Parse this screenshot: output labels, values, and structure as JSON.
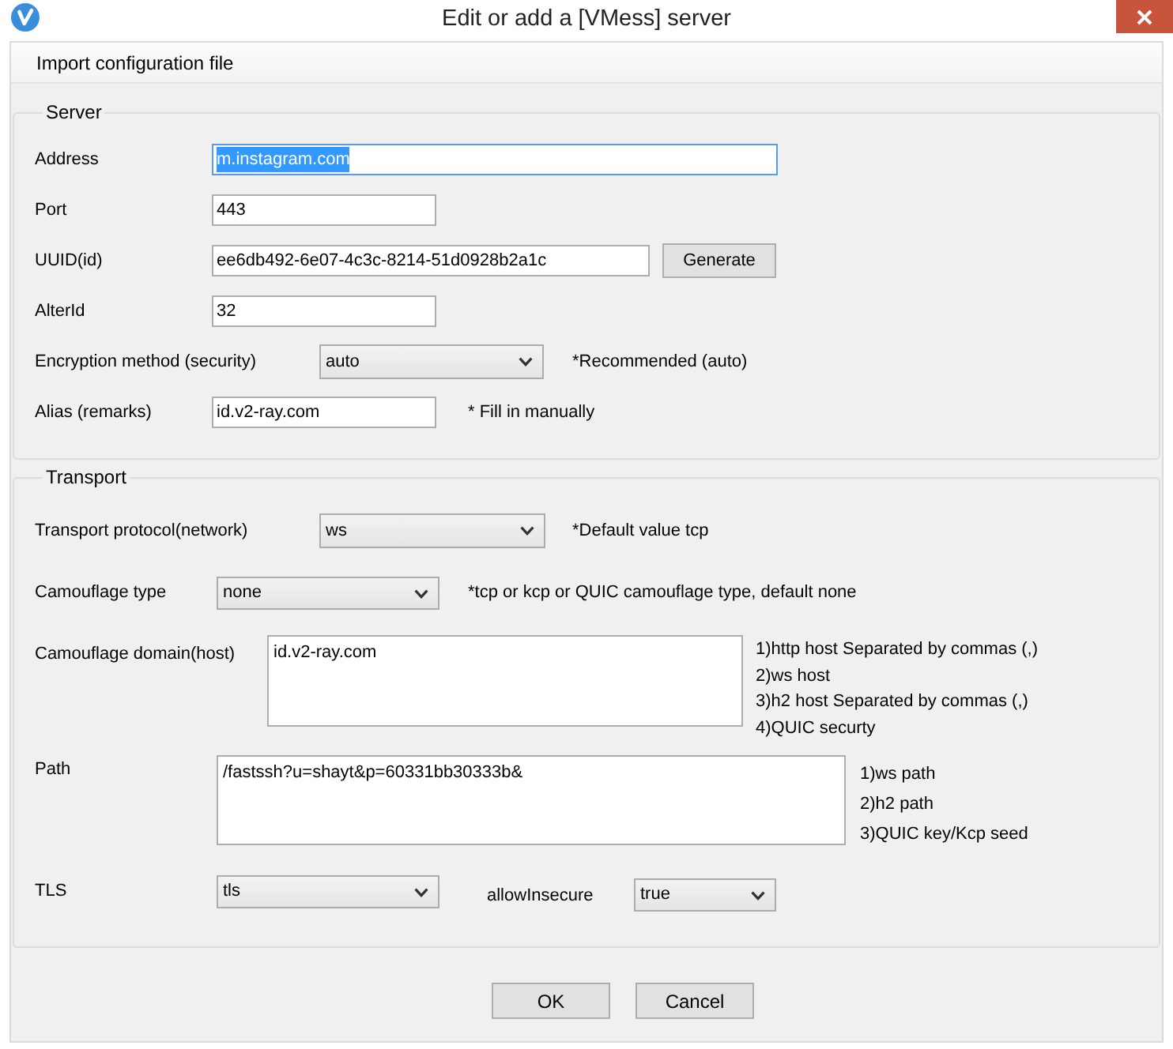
{
  "window": {
    "title": "Edit or add a [VMess] server"
  },
  "menu": [
    {
      "label": "Import configuration file"
    }
  ],
  "server": {
    "legend": "Server",
    "rows": [
      {
        "kind": "text",
        "label": "Address",
        "value": "m.instagram.com",
        "focused": true
      },
      {
        "kind": "text",
        "label": "Port",
        "value": "443",
        "focused": false
      },
      {
        "kind": "text_button",
        "label": "UUID(id)",
        "value": "ee6db492-6e07-4c3c-8214-51d0928b2a1c",
        "button": "Generate",
        "focused": false
      },
      {
        "kind": "text",
        "label": "AlterId",
        "value": "32",
        "focused": false
      },
      {
        "kind": "select",
        "label": "Encryption method (security)",
        "value": "auto",
        "note": "*Recommended (auto)",
        "focused": false
      },
      {
        "kind": "text",
        "label": "Alias (remarks)",
        "value": "id.v2-ray.com",
        "note": "* Fill in manually",
        "focused": false
      }
    ]
  },
  "transport": {
    "legend": "Transport",
    "rows": [
      {
        "kind": "select",
        "label": "Transport protocol(network)",
        "value": "ws",
        "note": "*Default value tcp",
        "focused": false
      },
      {
        "kind": "select",
        "label": "Camouflage type",
        "value": "none",
        "note": "*tcp or kcp or QUIC camouflage type, default none",
        "focused": false
      },
      {
        "kind": "textarea",
        "label": "Camouflage domain(host)",
        "value": "id.v2-ray.com",
        "notes": [
          "1)http host Separated by commas (,)",
          "2)ws host",
          "3)h2 host Separated by commas (,)",
          "4)QUIC securty"
        ],
        "focused": false
      },
      {
        "kind": "textarea",
        "label": "Path",
        "value": "/fastssh?u=shayt&p=60331bb30333b&",
        "notes": [
          "1)ws path",
          "2)h2 path",
          "3)QUIC key/Kcp seed"
        ],
        "focused": false
      },
      {
        "kind": "select_pair",
        "label": "TLS",
        "value": "tls",
        "extra": {
          "label": "allowInsecure",
          "value": "true"
        },
        "focused": false
      }
    ]
  },
  "buttons": [
    {
      "label": "OK"
    },
    {
      "label": "Cancel"
    }
  ]
}
